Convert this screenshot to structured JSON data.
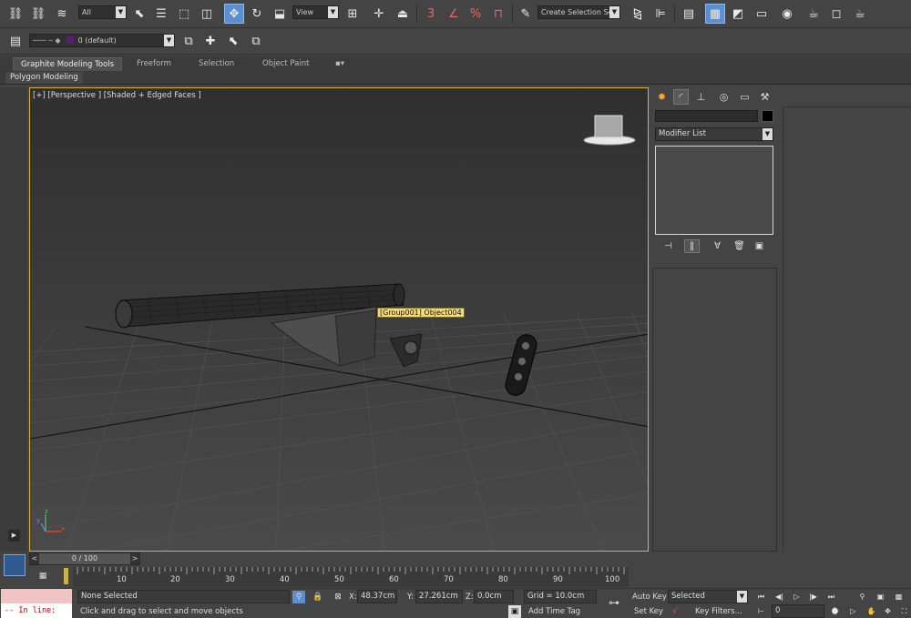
{
  "toolbar": {
    "selection_filter": "All",
    "ref_coord": "View",
    "named_selection_placeholder": "Create Selection Se",
    "snap_3": "3",
    "snap_angle": "∠",
    "snap_percent": "%",
    "layer_name": "0 (default)"
  },
  "ribbon": {
    "tabs": [
      "Graphite Modeling Tools",
      "Freeform",
      "Selection",
      "Object Paint"
    ],
    "active_tab": "Graphite Modeling Tools",
    "subtab": "Polygon Modeling"
  },
  "viewport": {
    "label": "[+] [Perspective ] [Shaded + Edged Faces ]",
    "tooltip": "[Group001] Object004",
    "gizmo_axes": {
      "x": "x",
      "y": "y",
      "z": "z"
    }
  },
  "command_panel": {
    "modifier_list": "Modifier List"
  },
  "time": {
    "frame_display": "0 / 100",
    "prev": "<",
    "next": ">",
    "ticks": [
      "10",
      "20",
      "30",
      "40",
      "50",
      "60",
      "70",
      "80",
      "90",
      "100"
    ]
  },
  "status": {
    "maxscript_text": "-- In line:",
    "selection": "None Selected",
    "prompt": "Click and drag to select and move objects",
    "x_label": "X:",
    "x_value": "48.37cm",
    "y_label": "Y:",
    "y_value": "27.261cm",
    "z_label": "Z:",
    "z_value": "0.0cm",
    "grid": "Grid = 10.0cm",
    "add_time_tag": "Add Time Tag",
    "auto_key": "Auto Key",
    "set_key": "Set Key",
    "key_mode": "Selected",
    "key_filters": "Key Filters...",
    "current_frame": "0"
  },
  "colors": {
    "accent": "#5b8fd1",
    "viewport_border": "#d6b04b",
    "tooltip_bg": "#f3dd7a",
    "object_color": "#5a1e7a"
  }
}
